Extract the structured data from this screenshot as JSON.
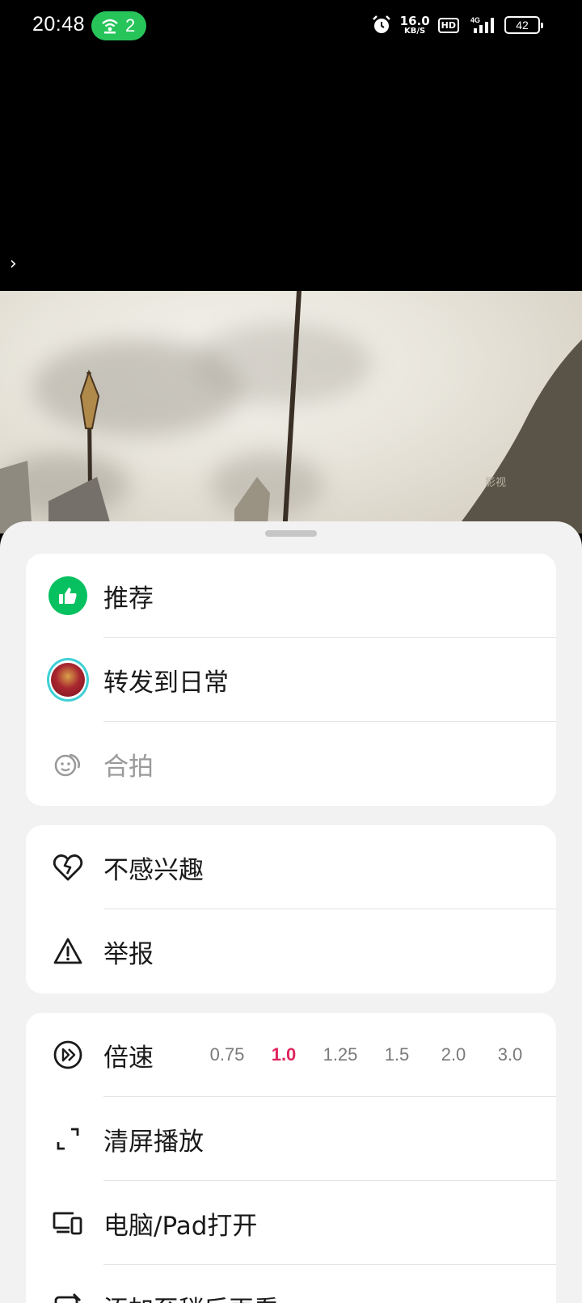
{
  "status_bar": {
    "time": "20:48",
    "hotspot_count": "2",
    "net_speed_value": "16.0",
    "net_speed_unit": "KB/S",
    "hd_label": "HD",
    "network_type": "4G",
    "battery": "42"
  },
  "video": {
    "watermark": "影视"
  },
  "sheet": {
    "group1": [
      {
        "label": "推荐",
        "icon": "thumbs-up-icon"
      },
      {
        "label": "转发到日常",
        "icon": "avatar-icon"
      },
      {
        "label": "合拍",
        "icon": "duet-icon",
        "disabled": true
      }
    ],
    "group2": [
      {
        "label": "不感兴趣",
        "icon": "broken-heart-icon"
      },
      {
        "label": "举报",
        "icon": "warning-icon"
      }
    ],
    "group3": [
      {
        "label": "倍速",
        "icon": "speed-icon"
      },
      {
        "label": "清屏播放",
        "icon": "fullscreen-icon"
      },
      {
        "label": "电脑/Pad打开",
        "icon": "devices-icon"
      },
      {
        "label": "添加至稍后再看",
        "icon": "watch-later-icon"
      }
    ],
    "speed_options": [
      "0.75",
      "1.0",
      "1.25",
      "1.5",
      "2.0",
      "3.0"
    ],
    "selected_speed": "1.0"
  },
  "colors": {
    "accent_green": "#07c160",
    "active_speed": "#e0245e"
  }
}
